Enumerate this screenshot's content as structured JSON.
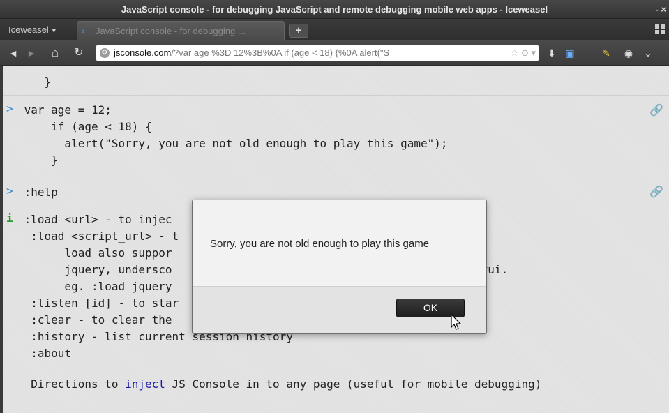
{
  "window": {
    "title": "JavaScript console - for debugging JavaScript and remote debugging mobile web apps - Iceweasel",
    "wm_button": "- ×"
  },
  "tabbar": {
    "app_menu": "Iceweasel",
    "active_tab": "JavaScript console - for debugging ...",
    "new_tab": "+"
  },
  "navbar": {
    "back": "◄",
    "forward": "►",
    "home": "⌂",
    "reload": "↻",
    "url_domain": "jsconsole.com",
    "url_rest": "/?var age %3D 12%3B%0A     if (age < 18) {%0A       alert(\"S",
    "url_controls": "☆ ⊙ ▾",
    "download": "⬇",
    "bookmarks": "▣",
    "tools": "✎",
    "addon": "◉",
    "menu": "⌄"
  },
  "console": {
    "entries": [
      {
        "lines": [
          "    }"
        ]
      },
      {
        "prompt": ">",
        "lines": [
          " var age = 12;",
          "     if (age < 18) {",
          "       alert(\"Sorry, you are not old enough to play this game\");",
          "     }"
        ]
      },
      {
        "prompt": ">",
        "lines": [
          " :help"
        ]
      }
    ],
    "help": {
      "marker": "i",
      "lines": [
        " :load <url> - to injec",
        "  :load <script_url> - t",
        "       load also suppor",
        "       jquery, undersco                                coffeescript, yui.",
        "       eg. :load jquery",
        "  :listen [id] - to star",
        "  :clear - to clear the",
        "  :history - list current session history",
        "  :about"
      ],
      "directions_prefix": "  Directions to ",
      "directions_link": "inject",
      "directions_suffix": " JS Console in to any page (useful for mobile debugging)"
    }
  },
  "dialog": {
    "message": "Sorry, you are not old enough to play this game",
    "ok_label": "OK"
  }
}
